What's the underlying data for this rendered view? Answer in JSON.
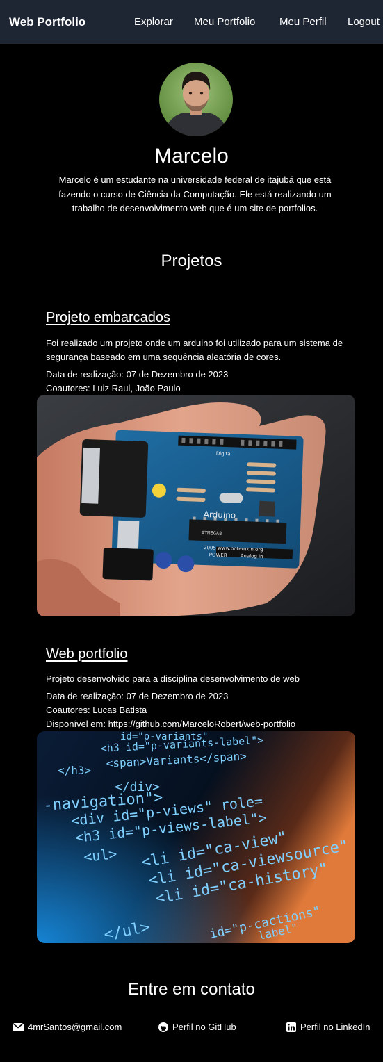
{
  "navbar": {
    "brand": "Web Portfolio",
    "links": [
      "Explorar",
      "Meu Portfolio",
      "Meu Perfil",
      "Logout"
    ]
  },
  "profile": {
    "name": "Marcelo",
    "bio": "Marcelo é um estudante na universidade federal de itajubá que está fazendo o curso de Ciência da Computação. Ele está realizando um trabalho de desenvolvimento web que é um site de portfolios."
  },
  "projects_section": {
    "title": "Projetos",
    "projects": [
      {
        "title": "Projeto embarcados",
        "description": "Foi realizado um projeto onde um arduino foi utilizado para um sistema de segurança baseado em uma sequência aleatória de cores.",
        "date": "Data de realização: 07 de Dezembro de 2023",
        "coauthors": "Coautores: Luiz Raul, João Paulo",
        "image_icon": "arduino-board-photo"
      },
      {
        "title": "Web portfolio",
        "description": "Projeto desenvolvido para a disciplina desenvolvimento de web",
        "date": "Data de realização: 07 de Dezembro de 2023",
        "coauthors": "Coautores: Lucas Batista",
        "available": "Disponível em: https://github.com/MarceloRobert/web-portfolio",
        "image_icon": "code-screen-photo"
      }
    ]
  },
  "contact": {
    "title": "Entre em contato",
    "email": "4mrSantos@gmail.com",
    "github": "Perfil no GitHub",
    "linkedin": "Perfil no LinkedIn"
  },
  "code_lines": {
    "l1": "id=\"p-variants\"",
    "l2": "<h3 id=\"p-variants-label\">",
    "l3": "<span>Variants</span>",
    "l4": "</h3>",
    "l5": "</div>",
    "l6": "-navigation\">",
    "l7": "<div id=\"p-views\" role=",
    "l8": "<h3 id=\"p-views-label\">",
    "l9": "<ul>",
    "l10": "<li id=\"ca-view\"",
    "l11": "<li id=\"ca-viewsource\"",
    "l12": "<li id=\"ca-history\"",
    "l13": "</ul>",
    "l14": "id=\"p-cactions\"",
    "l15": "label\""
  },
  "board_labels": {
    "brand": "Arduino",
    "chip": "ATMEGA8",
    "analog": "Analog in",
    "digital": "Digital",
    "power": "POWER",
    "site": "2005 www.potemkin.org"
  }
}
